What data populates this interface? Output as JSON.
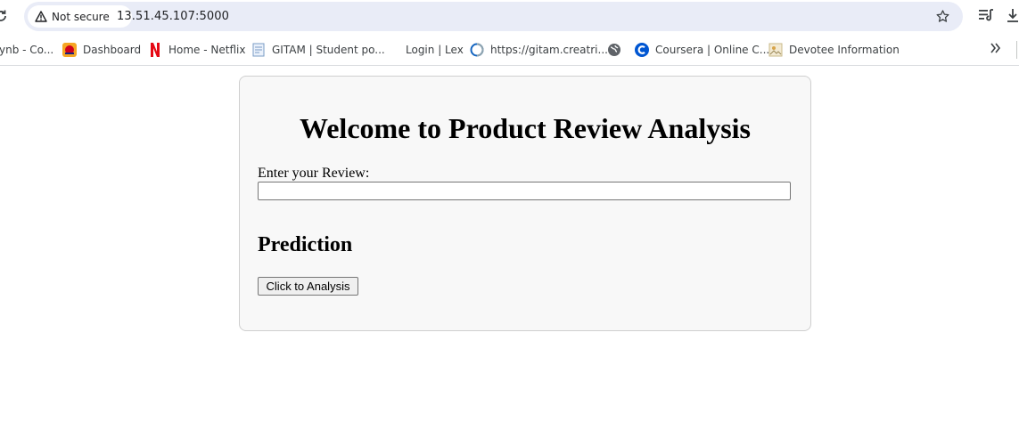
{
  "browser": {
    "security_label": "Not secure",
    "url": "13.51.45.107:5000"
  },
  "bookmarks": [
    {
      "label": "ynb - Co...",
      "icon": "none"
    },
    {
      "label": "Dashboard",
      "icon": "dashboard-icon"
    },
    {
      "label": "Home - Netflix",
      "icon": "netflix-icon"
    },
    {
      "label": "GITAM | Student po...",
      "icon": "document-icon"
    },
    {
      "label": "Login | Lex",
      "icon": "none"
    },
    {
      "label": "https://gitam.creatri...",
      "icon": "circle-logo-icon"
    },
    {
      "label": "",
      "icon": "globe-icon"
    },
    {
      "label": "Coursera | Online C...",
      "icon": "coursera-icon"
    },
    {
      "label": "Devotee Information",
      "icon": "image-icon"
    }
  ],
  "page": {
    "title": "Welcome to Product Review Analysis",
    "review_label": "Enter your Review:",
    "review_value": "",
    "review_placeholder": "",
    "prediction_heading": "Prediction",
    "analyze_button": "Click to Analysis"
  },
  "colors": {
    "omnibox_bg": "#e9ecf7",
    "card_bg": "#f8f8f8",
    "netflix_red": "#e50914",
    "coursera_blue": "#0056d2"
  }
}
